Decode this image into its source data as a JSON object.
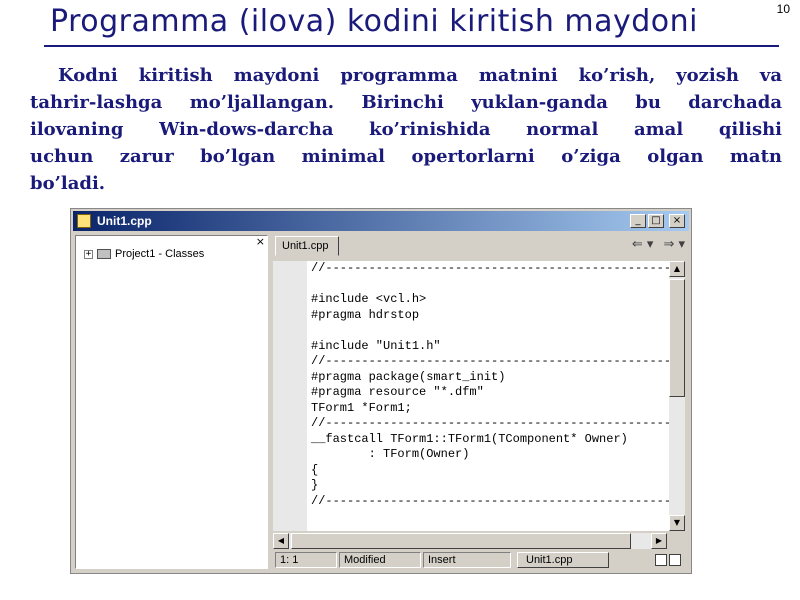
{
  "slide": {
    "page_number": "10",
    "title": "Programma (ilova) kodini kiritish maydoni",
    "paragraph_lines": [
      "Kodni kiritish maydoni programma matnini ko’rish, yozish va",
      "tahrir-lashga mo’ljallangan. Birinchi yuklan-ganda bu darchada",
      "ilovaning Win-dows-darcha ko’rinishida normal amal qilishi",
      "uchun zarur bo’lgan minimal opertorlarni o’ziga olgan matn",
      "bo’ladi."
    ]
  },
  "window": {
    "title": "Unit1.cpp",
    "controls": {
      "minimize": "_",
      "maximize": "□",
      "close": "×"
    }
  },
  "class_explorer": {
    "close_label": "×",
    "items": [
      {
        "expander": "+",
        "label": "Project1 - Classes"
      }
    ]
  },
  "editor": {
    "tab_label": "Unit1.cpp",
    "nav": {
      "back": "⇐ ▾",
      "forward": "⇒ ▾"
    },
    "code_lines": [
      "//--------------------------------------------------",
      "",
      "#include <vcl.h>",
      "#pragma hdrstop",
      "",
      "#include \"Unit1.h\"",
      "//--------------------------------------------------",
      "#pragma package(smart_init)",
      "#pragma resource \"*.dfm\"",
      "TForm1 *Form1;",
      "//--------------------------------------------------",
      "__fastcall TForm1::TForm1(TComponent* Owner)",
      "        : TForm(Owner)",
      "{",
      "}",
      "//--------------------------------------------------"
    ]
  },
  "statusbar": {
    "position": "1:  1",
    "modified": "Modified",
    "insert": "Insert",
    "tab": "Unit1.cpp"
  }
}
